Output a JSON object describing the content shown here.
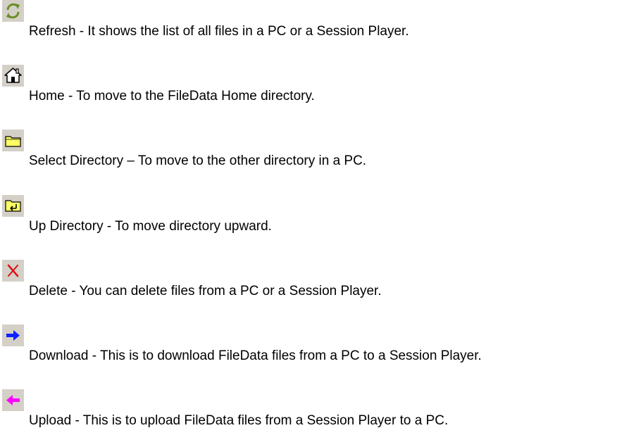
{
  "entries": [
    {
      "icon": "refresh-icon",
      "text": "Refresh - It shows the list of all files in a PC or a Session Player."
    },
    {
      "icon": "home-icon",
      "text": "Home - To move to the FileData Home directory."
    },
    {
      "icon": "folder-icon",
      "text": "Select Directory – To move to the other directory in a PC."
    },
    {
      "icon": "up-directory-icon",
      "text": "Up Directory - To move directory upward."
    },
    {
      "icon": "delete-icon",
      "text": "Delete - You can delete files from a PC or a Session Player."
    },
    {
      "icon": "download-arrow-icon",
      "text": "Download - This is to download FileData files from a PC to a Session Player."
    },
    {
      "icon": "upload-arrow-icon",
      "text": "Upload - This is to upload FileData files from a Session Player to a PC."
    }
  ],
  "colors": {
    "button_face": "#d4d0c8",
    "refresh_green": "#6b8e23",
    "folder_yellow": "#ffff66",
    "delete_red": "#e01010",
    "download_blue": "#1020ff",
    "upload_magenta": "#ff00ff",
    "text": "#000000"
  }
}
